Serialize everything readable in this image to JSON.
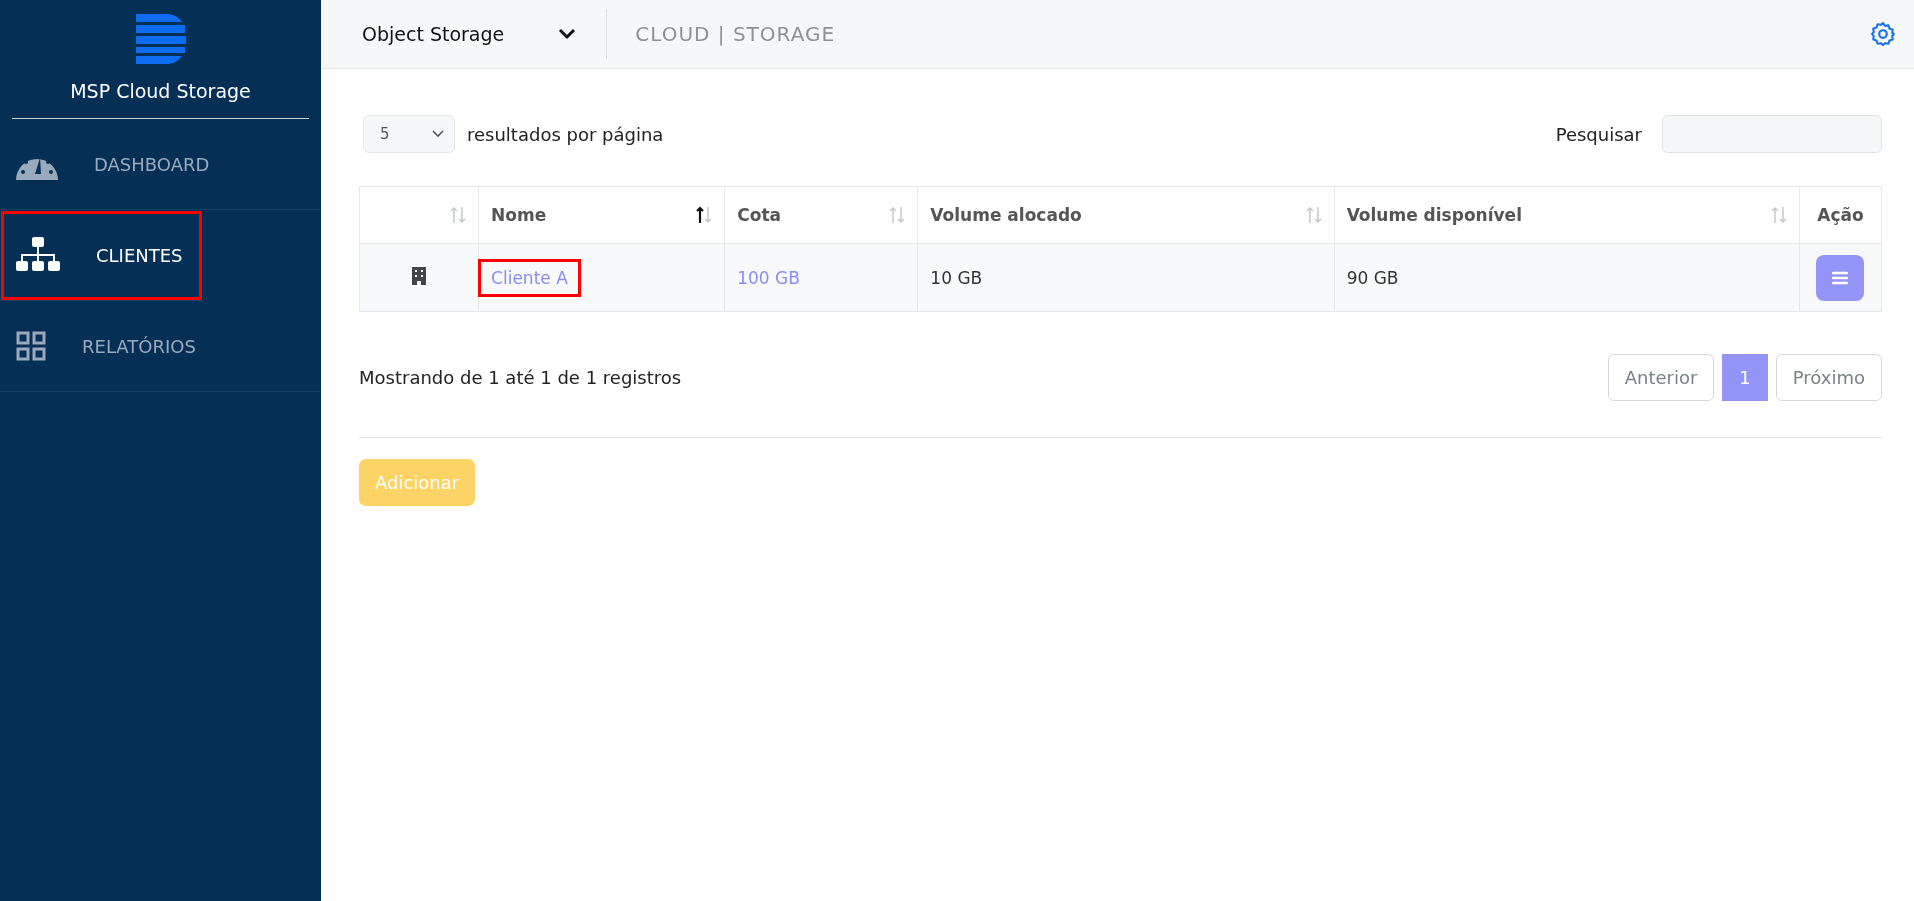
{
  "sidebar": {
    "brand": "MSP Cloud Storage",
    "items": [
      {
        "label": "DASHBOARD",
        "kind": "gauge",
        "selected": false,
        "highlighted": false
      },
      {
        "label": "CLIENTES",
        "kind": "sitemap",
        "selected": true,
        "highlighted": true
      },
      {
        "label": "RELATÓRIOS",
        "kind": "grid",
        "selected": false,
        "highlighted": false
      }
    ]
  },
  "header": {
    "product": "Object Storage",
    "breadcrumb": "CLOUD | STORAGE"
  },
  "controls": {
    "page_size": "5",
    "page_size_label": "resultados por página",
    "search_label": "Pesquisar"
  },
  "table": {
    "columns": [
      {
        "sortable": true,
        "sorted": false
      },
      {
        "label": "Nome",
        "sortable": true,
        "sorted": true
      },
      {
        "label": "Cota",
        "sortable": true,
        "sorted": false
      },
      {
        "label": "Volume alocado",
        "sortable": true,
        "sorted": false
      },
      {
        "label": "Volume disponível",
        "sortable": true,
        "sorted": false
      },
      {
        "label": "Ação",
        "sortable": false
      }
    ],
    "rows": [
      {
        "name": "Cliente A",
        "name_highlighted": true,
        "quota": "100 GB",
        "allocated": "10 GB",
        "available": "90 GB"
      }
    ]
  },
  "footer": {
    "info": "Mostrando de 1 até 1 de 1 registros",
    "pages": [
      {
        "label": "Anterior",
        "kind": "nav",
        "disabled": true
      },
      {
        "label": "1",
        "kind": "page",
        "selected": true
      },
      {
        "label": "Próximo",
        "kind": "nav",
        "disabled": true
      }
    ]
  },
  "add_button": "Adicionar"
}
